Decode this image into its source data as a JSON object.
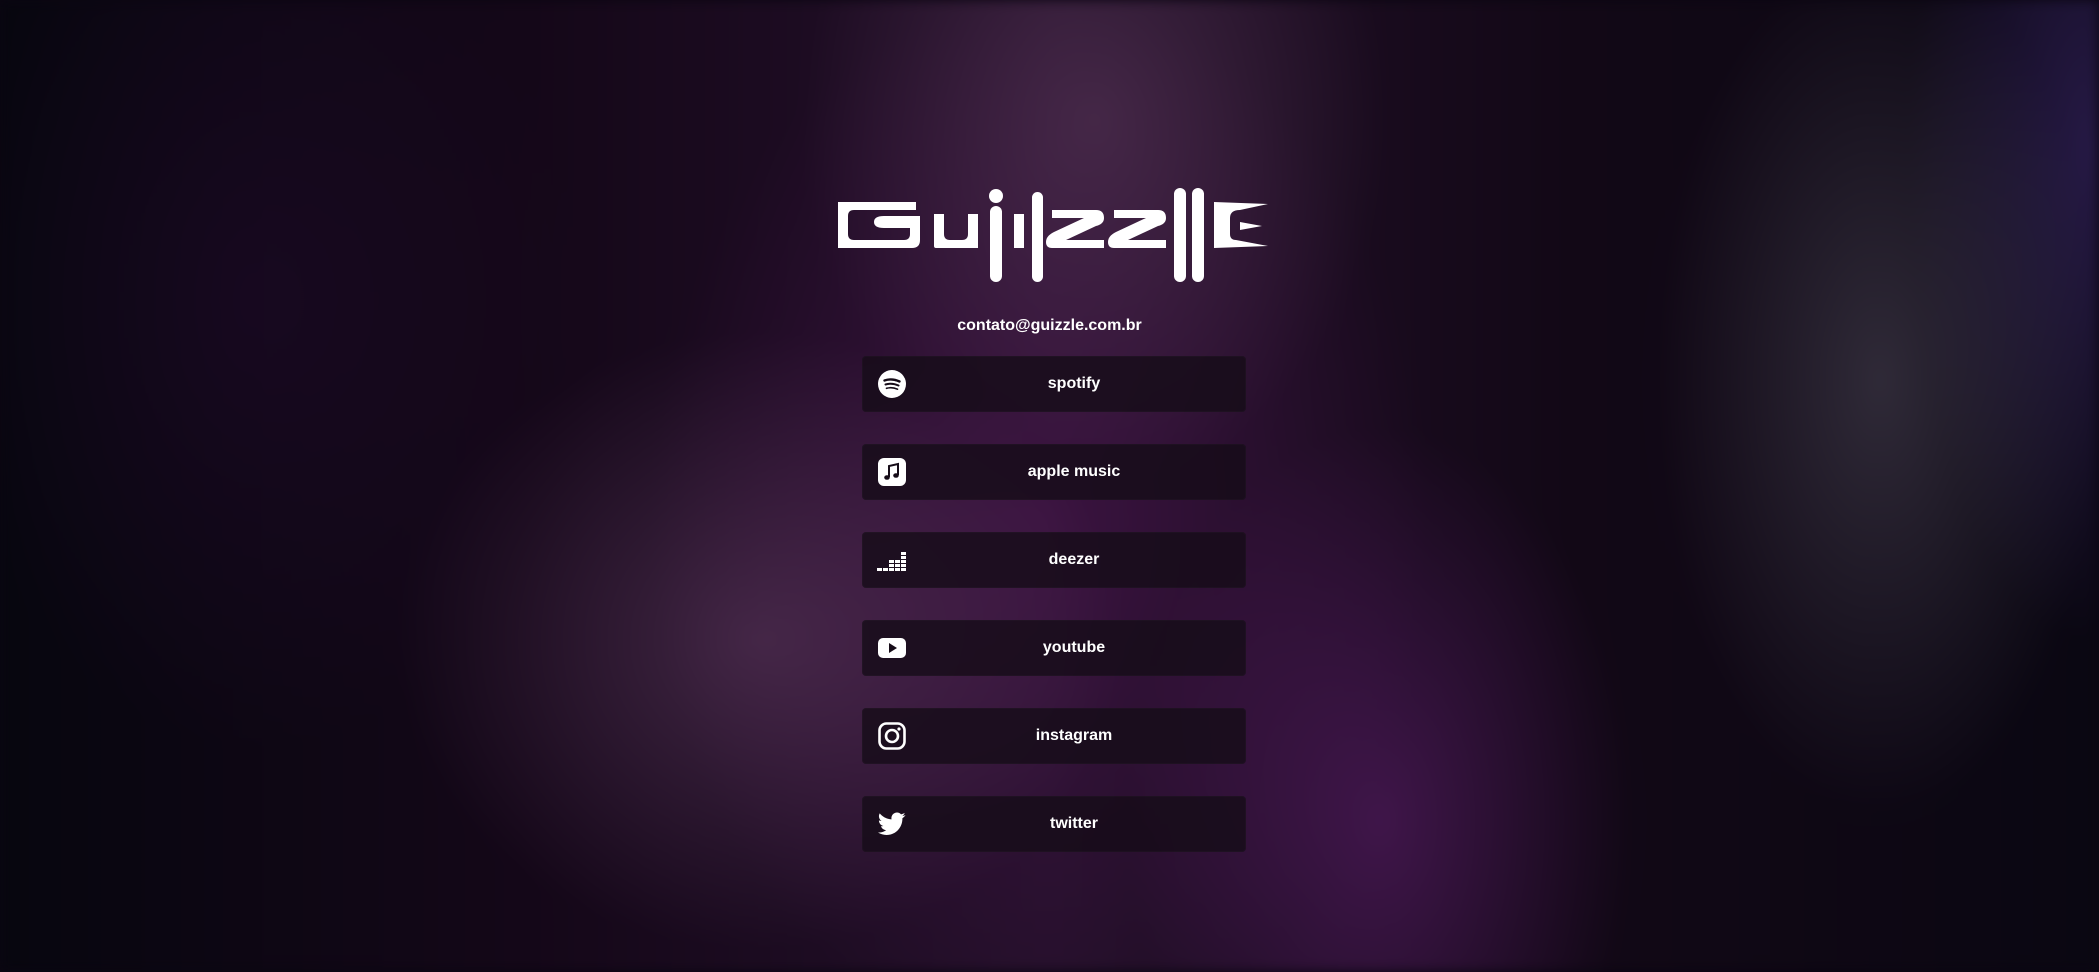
{
  "brand": {
    "logo_text": "guizzle",
    "logo_icon": "guizzle-wordmark-logo"
  },
  "contact": {
    "email": "contato@guizzle.com.br"
  },
  "links": [
    {
      "label": "spotify",
      "icon": "spotify-icon"
    },
    {
      "label": "apple music",
      "icon": "apple-music-icon"
    },
    {
      "label": "deezer",
      "icon": "deezer-icon"
    },
    {
      "label": "youtube",
      "icon": "youtube-icon"
    },
    {
      "label": "instagram",
      "icon": "instagram-icon"
    },
    {
      "label": "twitter",
      "icon": "twitter-icon"
    }
  ],
  "colors": {
    "text": "#ffffff",
    "button_bg": "#160c18",
    "background_dark": "#0b0611",
    "background_purple": "#3a1442"
  }
}
